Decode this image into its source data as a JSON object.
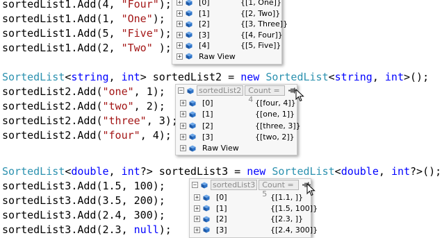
{
  "code_lines": [
    {
      "tokens": [
        {
          "t": "sortedList1.Add(4, ",
          "c": "plain"
        },
        {
          "t": "\"Four\"",
          "c": "str"
        },
        {
          "t": ");",
          "c": "plain"
        }
      ]
    },
    {
      "tokens": [
        {
          "t": "sortedList1.Add(1, ",
          "c": "plain"
        },
        {
          "t": "\"One\"",
          "c": "str"
        },
        {
          "t": ");",
          "c": "plain"
        }
      ]
    },
    {
      "tokens": [
        {
          "t": "sortedList1.Add(5, ",
          "c": "plain"
        },
        {
          "t": "\"Five\"",
          "c": "str"
        },
        {
          "t": ");",
          "c": "plain"
        }
      ]
    },
    {
      "tokens": [
        {
          "t": "sortedList1.Add(2, ",
          "c": "plain"
        },
        {
          "t": "\"Two\"",
          "c": "str"
        },
        {
          "t": " );",
          "c": "plain"
        }
      ]
    },
    {
      "tokens": []
    },
    {
      "tokens": [
        {
          "t": "SortedList",
          "c": "type"
        },
        {
          "t": "<",
          "c": "plain"
        },
        {
          "t": "string",
          "c": "kw"
        },
        {
          "t": ", ",
          "c": "plain"
        },
        {
          "t": "int",
          "c": "kw"
        },
        {
          "t": "> sortedList2 = ",
          "c": "plain"
        },
        {
          "t": "new",
          "c": "kw"
        },
        {
          "t": " ",
          "c": "plain"
        },
        {
          "t": "SortedList",
          "c": "type"
        },
        {
          "t": "<",
          "c": "plain"
        },
        {
          "t": "string",
          "c": "kw"
        },
        {
          "t": ", ",
          "c": "plain"
        },
        {
          "t": "int",
          "c": "kw"
        },
        {
          "t": ">();",
          "c": "plain"
        }
      ]
    },
    {
      "tokens": [
        {
          "t": "sortedList2.Add(",
          "c": "plain"
        },
        {
          "t": "\"one\"",
          "c": "str"
        },
        {
          "t": ", 1);",
          "c": "plain"
        }
      ]
    },
    {
      "tokens": [
        {
          "t": "sortedList2.Add(",
          "c": "plain"
        },
        {
          "t": "\"two\"",
          "c": "str"
        },
        {
          "t": ", 2);",
          "c": "plain"
        }
      ]
    },
    {
      "tokens": [
        {
          "t": "sortedList2.Add(",
          "c": "plain"
        },
        {
          "t": "\"three\"",
          "c": "str"
        },
        {
          "t": ", 3);",
          "c": "plain"
        }
      ]
    },
    {
      "tokens": [
        {
          "t": "sortedList2.Add(",
          "c": "plain"
        },
        {
          "t": "\"four\"",
          "c": "str"
        },
        {
          "t": ", 4);",
          "c": "plain"
        }
      ]
    },
    {
      "tokens": []
    },
    {
      "tokens": [
        {
          "t": "SortedList",
          "c": "type"
        },
        {
          "t": "<",
          "c": "plain"
        },
        {
          "t": "double",
          "c": "kw"
        },
        {
          "t": ", ",
          "c": "plain"
        },
        {
          "t": "int",
          "c": "kw"
        },
        {
          "t": "?> sortedList3 = ",
          "c": "plain"
        },
        {
          "t": "new",
          "c": "kw"
        },
        {
          "t": " ",
          "c": "plain"
        },
        {
          "t": "SortedList",
          "c": "type"
        },
        {
          "t": "<",
          "c": "plain"
        },
        {
          "t": "double",
          "c": "kw"
        },
        {
          "t": ", ",
          "c": "plain"
        },
        {
          "t": "int",
          "c": "kw"
        },
        {
          "t": "?>();",
          "c": "plain"
        }
      ]
    },
    {
      "tokens": [
        {
          "t": "sortedList3.Add(1.5, 100);",
          "c": "plain"
        }
      ]
    },
    {
      "tokens": [
        {
          "t": "sortedList3.Add(3.5, 200);",
          "c": "plain"
        }
      ]
    },
    {
      "tokens": [
        {
          "t": "sortedList3.Add(2.4, 300);",
          "c": "plain"
        }
      ]
    },
    {
      "tokens": [
        {
          "t": "sortedList3.Add(2.3, ",
          "c": "plain"
        },
        {
          "t": "null",
          "c": "kw"
        },
        {
          "t": ");",
          "c": "plain"
        }
      ]
    }
  ],
  "colors": {
    "plain": "#000000",
    "str": "#a31515",
    "kw": "#0000ff",
    "type": "#2b91af",
    "cube": "#1e5aa8"
  },
  "datatips": [
    {
      "id": "sortedList1",
      "header": null,
      "rows": [
        {
          "name": "[0]",
          "value": "{[1, One]}"
        },
        {
          "name": "[1]",
          "value": "{[2, Two]}"
        },
        {
          "name": "[2]",
          "value": "{[3, Three]}"
        },
        {
          "name": "[3]",
          "value": "{[4, Four]}"
        },
        {
          "name": "[4]",
          "value": "{[5, Five]}"
        },
        {
          "name": "Raw View",
          "value": ""
        }
      ]
    },
    {
      "id": "sortedList2",
      "header": {
        "name": "sortedList2",
        "count": "Count = 4"
      },
      "rows": [
        {
          "name": "[0]",
          "value": "{[four, 4]}"
        },
        {
          "name": "[1]",
          "value": "{[one, 1]}"
        },
        {
          "name": "[2]",
          "value": "{[three, 3]}"
        },
        {
          "name": "[3]",
          "value": "{[two, 2]}"
        },
        {
          "name": "Raw View",
          "value": ""
        }
      ]
    },
    {
      "id": "sortedList3",
      "header": {
        "name": "sortedList3",
        "count": "Count = 5"
      },
      "rows": [
        {
          "name": "[0]",
          "value": "{[1.1, ]}"
        },
        {
          "name": "[1]",
          "value": "{[1.5, 100]}"
        },
        {
          "name": "[2]",
          "value": "{[2.3, ]}"
        },
        {
          "name": "[3]",
          "value": "{[2.4, 300]}"
        }
      ]
    }
  ],
  "icons": {
    "expander": "+",
    "collapse": "−",
    "item": "cube-icon",
    "pin": "pin-icon",
    "cursor": "mouse-cursor-icon"
  }
}
